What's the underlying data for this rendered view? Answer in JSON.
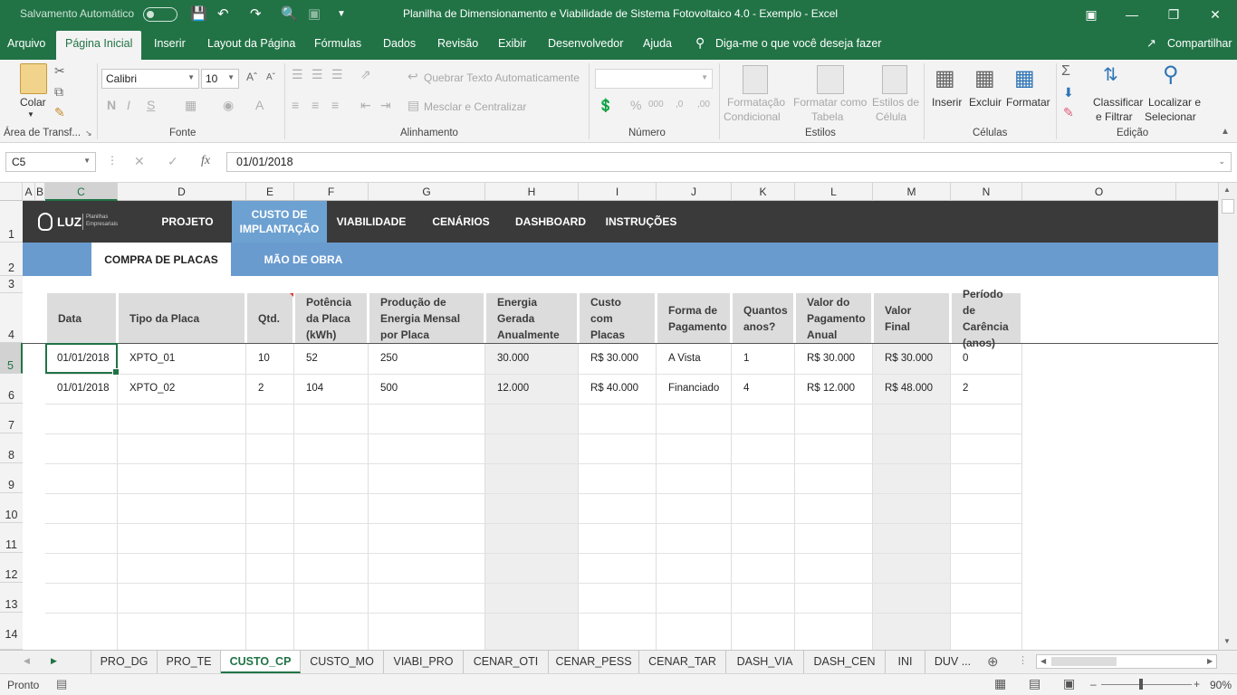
{
  "titlebar": {
    "autosave_label": "Salvamento Automático",
    "title": "Planilha de Dimensionamento e Viabilidade de Sistema Fotovoltaico 4.0 - Exemplo  -  Excel"
  },
  "ribbon_tabs": [
    "Arquivo",
    "Página Inicial",
    "Inserir",
    "Layout da Página",
    "Fórmulas",
    "Dados",
    "Revisão",
    "Exibir",
    "Desenvolvedor",
    "Ajuda"
  ],
  "tell_me": "Diga-me o que você deseja fazer",
  "share": "Compartilhar",
  "ribbon": {
    "clipboard": {
      "paste": "Colar",
      "label": "Área de Transf..."
    },
    "font": {
      "name": "Calibri",
      "size": "10",
      "label": "Fonte"
    },
    "alignment": {
      "wrap": "Quebrar Texto Automaticamente",
      "merge": "Mesclar e Centralizar",
      "label": "Alinhamento"
    },
    "number": {
      "label": "Número"
    },
    "styles": {
      "cond1": "Formatação",
      "cond2": "Condicional",
      "table1": "Formatar como",
      "table2": "Tabela",
      "cell1": "Estilos de",
      "cell2": "Célula",
      "label": "Estilos"
    },
    "cells": {
      "insert": "Inserir",
      "delete": "Excluir",
      "format": "Formatar",
      "label": "Células"
    },
    "editing": {
      "sort1": "Classificar",
      "sort2": "e Filtrar",
      "find1": "Localizar e",
      "find2": "Selecionar",
      "label": "Edição"
    }
  },
  "formula_bar": {
    "name_box": "C5",
    "fx": "fx",
    "value": "01/01/2018"
  },
  "columns": [
    "A",
    "B",
    "C",
    "D",
    "E",
    "F",
    "G",
    "H",
    "I",
    "J",
    "K",
    "L",
    "M",
    "N",
    "O"
  ],
  "rows": [
    "1",
    "2",
    "3",
    "4",
    "5",
    "6",
    "7",
    "8",
    "9",
    "10",
    "11",
    "12",
    "13",
    "14"
  ],
  "nav": {
    "logo": "LUZ",
    "logo_sub1": "Planilhas",
    "logo_sub2": "Empresariais",
    "items": [
      "PROJETO",
      "CUSTO DE IMPLANTAÇÃO",
      "VIABILIDADE",
      "CENÁRIOS",
      "DASHBOARD",
      "INSTRUÇÕES"
    ],
    "active": "CUSTO DE IMPLANTAÇÃO"
  },
  "subnav": {
    "items": [
      "COMPRA DE PLACAS",
      "MÃO DE OBRA"
    ],
    "active": "COMPRA DE PLACAS"
  },
  "table": {
    "headers": [
      "Data",
      "Tipo da Placa",
      "Qtd.",
      "Potência da Placa (kWh)",
      "Produção de Energia Mensal  por Placa",
      "Energia Gerada Anualmente",
      "Custo com Placas",
      "Forma de Pagamento",
      "Quantos anos?",
      "Valor do Pagamento Anual",
      "Valor Final",
      "Período de Carência (anos)"
    ],
    "rows": [
      [
        "01/01/2018",
        "XPTO_01",
        "10",
        "52",
        "250",
        "30.000",
        "R$ 30.000",
        "A Vista",
        "1",
        "R$ 30.000",
        "R$ 30.000",
        "0"
      ],
      [
        "01/01/2018",
        "XPTO_02",
        "2",
        "104",
        "500",
        "12.000",
        "R$ 40.000",
        "Financiado",
        "4",
        "R$ 12.000",
        "R$ 48.000",
        "2"
      ]
    ]
  },
  "sheet_tabs": [
    "PRO_DG",
    "PRO_TE",
    "CUSTO_CP",
    "CUSTO_MO",
    "VIABI_PRO",
    "CENAR_OTI",
    "CENAR_PESS",
    "CENAR_TAR",
    "DASH_VIA",
    "DASH_CEN",
    "INI",
    "DUV ..."
  ],
  "active_sheet": "CUSTO_CP",
  "status": {
    "ready": "Pronto",
    "zoom": "90%"
  },
  "colors": {
    "excel_green": "#217346",
    "nav_dark": "#3a3a3a",
    "nav_active": "#6da1d1",
    "subnav": "#6a9bcf"
  }
}
